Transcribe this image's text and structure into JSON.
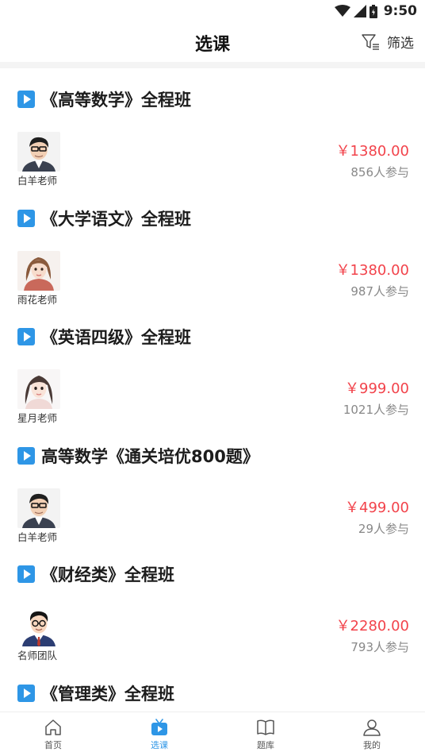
{
  "status_bar": {
    "time": "9:50"
  },
  "header": {
    "title": "选课",
    "filter_label": "筛选"
  },
  "courses": [
    {
      "title": "《高等数学》全程班",
      "teacher": "白羊老师",
      "price": "￥1380.00",
      "enrolled": "856人参与",
      "avatar": "man-glasses"
    },
    {
      "title": "《大学语文》全程班",
      "teacher": "雨花老师",
      "price": "￥1380.00",
      "enrolled": "987人参与",
      "avatar": "woman-brown-hair"
    },
    {
      "title": "《英语四级》全程班",
      "teacher": "星月老师",
      "price": "￥999.00",
      "enrolled": "1021人参与",
      "avatar": "woman-dark-hair"
    },
    {
      "title": "高等数学《通关培优800题》",
      "teacher": "白羊老师",
      "price": "￥499.00",
      "enrolled": "29人参与",
      "avatar": "man-glasses"
    },
    {
      "title": "《财经类》全程班",
      "teacher": "名师团队",
      "price": "￥2280.00",
      "enrolled": "793人参与",
      "avatar": "man-suit"
    },
    {
      "title": "《管理类》全程班",
      "teacher": "",
      "price": "",
      "enrolled": "",
      "avatar": ""
    }
  ],
  "tabs": [
    {
      "label": "首页",
      "icon": "home-icon"
    },
    {
      "label": "选课",
      "icon": "course-tv-icon",
      "active": true
    },
    {
      "label": "题库",
      "icon": "book-icon"
    },
    {
      "label": "我的",
      "icon": "user-icon"
    }
  ],
  "colors": {
    "accent": "#2e96e6",
    "price": "#f2434b"
  }
}
